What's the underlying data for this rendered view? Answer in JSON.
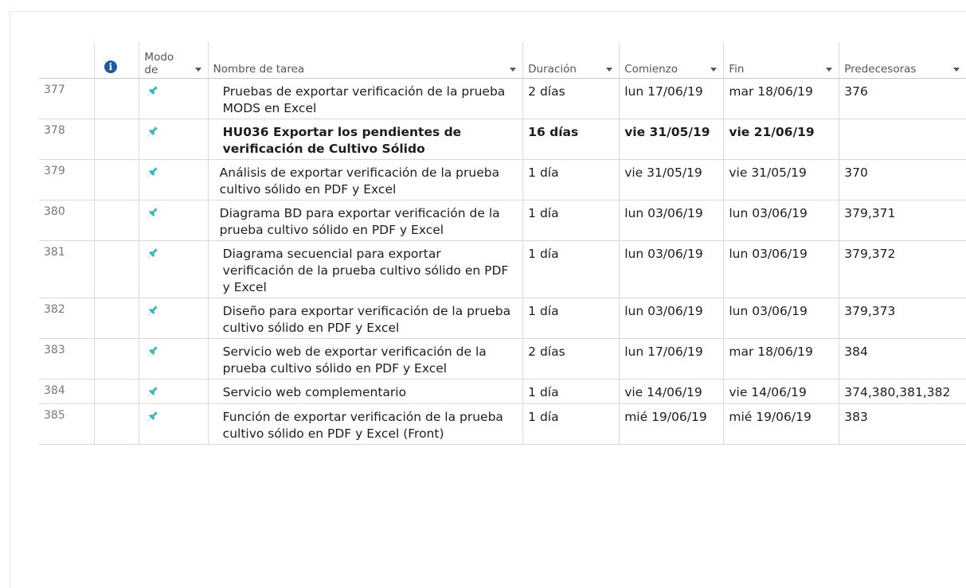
{
  "columns": {
    "mode_line1": "Modo",
    "mode_line2": "de",
    "name": "Nombre de tarea",
    "duration": "Duración",
    "start": "Comienzo",
    "end": "Fin",
    "predecessors": "Predecesoras"
  },
  "icons": {
    "info": "info-icon",
    "task_mode": "pushpin-icon",
    "pin_color": "#3cb8b2",
    "info_color": "#1f5a9e"
  },
  "rows": [
    {
      "id": "377",
      "name": "Pruebas de exportar verificación de la prueba MODS en Excel",
      "duration": "2 días",
      "start": "lun 17/06/19",
      "end": "mar 18/06/19",
      "predecessors": "376",
      "bold": false
    },
    {
      "id": "378",
      "name": "HU036 Exportar los pendientes de verificación de Cultivo Sólido",
      "duration": "16 días",
      "start": "vie 31/05/19",
      "end": "vie 21/06/19",
      "predecessors": "",
      "bold": true
    },
    {
      "id": "379",
      "name": "Análisis de exportar verificación de la prueba cultivo sólido en PDF y Excel",
      "duration": "1 día",
      "start": "vie 31/05/19",
      "end": "vie 31/05/19",
      "predecessors": "370",
      "bold": false
    },
    {
      "id": "380",
      "name": "Diagrama BD para exportar verificación de la prueba cultivo sólido en PDF y Excel",
      "duration": "1 día",
      "start": "lun 03/06/19",
      "end": "lun 03/06/19",
      "predecessors": "379,371",
      "bold": false
    },
    {
      "id": "381",
      "name": "Diagrama secuencial para exportar verificación de la prueba cultivo sólido en PDF y Excel",
      "duration": "1 día",
      "start": "lun 03/06/19",
      "end": "lun 03/06/19",
      "predecessors": "379,372",
      "bold": false
    },
    {
      "id": "382",
      "name": "Diseño para exportar verificación de la prueba cultivo sólido en PDF y Excel",
      "duration": "1 día",
      "start": "lun 03/06/19",
      "end": "lun 03/06/19",
      "predecessors": "379,373",
      "bold": false
    },
    {
      "id": "383",
      "name": "Servicio web de exportar verificación de la prueba cultivo sólido en PDF y Excel",
      "duration": "2 días",
      "start": "lun 17/06/19",
      "end": "mar 18/06/19",
      "predecessors": "384",
      "bold": false
    },
    {
      "id": "384",
      "name": "Servicio web complementario",
      "duration": "1 día",
      "start": "vie 14/06/19",
      "end": "vie 14/06/19",
      "predecessors": "374,380,381,382",
      "bold": false
    },
    {
      "id": "385",
      "name": "Función de exportar verificación de la prueba cultivo sólido en PDF y Excel (Front)",
      "duration": "1 día",
      "start": "mié 19/06/19",
      "end": "mié 19/06/19",
      "predecessors": "383",
      "bold": false
    }
  ]
}
